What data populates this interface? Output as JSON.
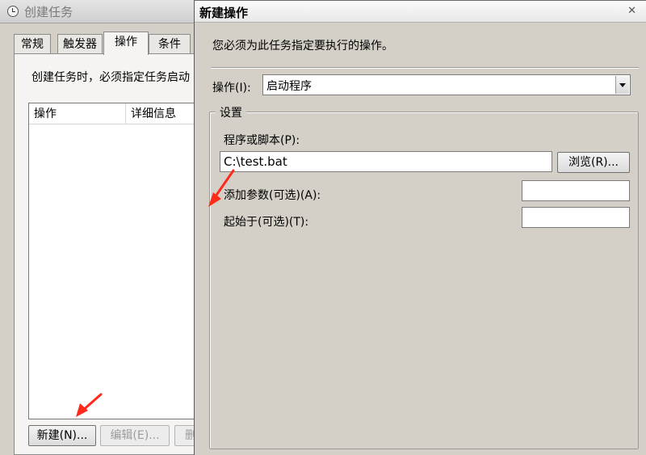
{
  "background_window": {
    "title": "创建任务",
    "tabs": [
      "常规",
      "触发器",
      "操作",
      "条件"
    ],
    "active_tab": "操作",
    "description": "创建任务时，必须指定任务启动",
    "list_columns": [
      "操作",
      "详细信息"
    ],
    "buttons": {
      "new": "新建(N)...",
      "edit": "编辑(E)...",
      "delete": "删"
    }
  },
  "dialog": {
    "title": "新建操作",
    "close_glyph": "✕",
    "description": "您必须为此任务指定要执行的操作。",
    "action_label": "操作(I):",
    "action_value": "启动程序",
    "settings_legend": "设置",
    "program_label": "程序或脚本(P):",
    "program_value": "C:\\test.bat",
    "browse_button": "浏览(R)...",
    "args_label": "添加参数(可选)(A):",
    "args_value": "",
    "start_in_label": "起始于(可选)(T):",
    "start_in_value": ""
  },
  "colors": {
    "annotation_arrow": "#ff2a1a",
    "window_face": "#d4d0c8"
  }
}
